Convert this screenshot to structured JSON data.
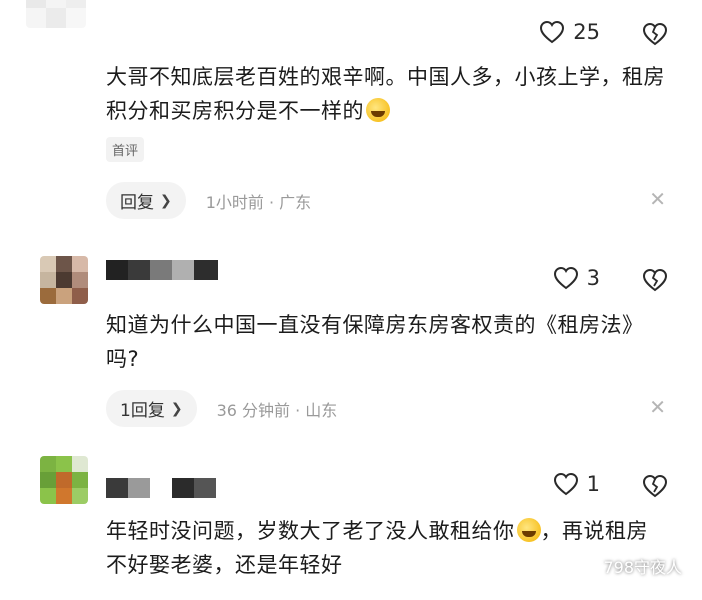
{
  "comments": [
    {
      "likes": "25",
      "text": "大哥不知底层老百姓的艰辛啊。中国人多，小孩上学，租房积分和买房积分是不一样的",
      "tag": "首评",
      "reply_label": "回复",
      "meta": "1小时前 · 广东"
    },
    {
      "likes": "3",
      "text": "知道为什么中国一直没有保障房东房客权责的《租房法》吗?",
      "reply_label": "1回复",
      "meta": "36 分钟前 · 山东"
    },
    {
      "likes": "1",
      "text_part1": "年轻时没问题，岁数大了老了没人敢租给你",
      "text_part2": "，再说租房不好娶老婆，还是年轻好"
    }
  ],
  "watermark": {
    "text": "798守夜人"
  },
  "icons": {
    "like": "heart-outline-icon",
    "dislike": "broken-heart-icon",
    "close": "close-icon",
    "emoji": "laughing-emoji-icon"
  },
  "colors": {
    "text": "#1c1c1c",
    "meta": "#9a9a9a",
    "chip_bg": "#f3f3f3"
  }
}
